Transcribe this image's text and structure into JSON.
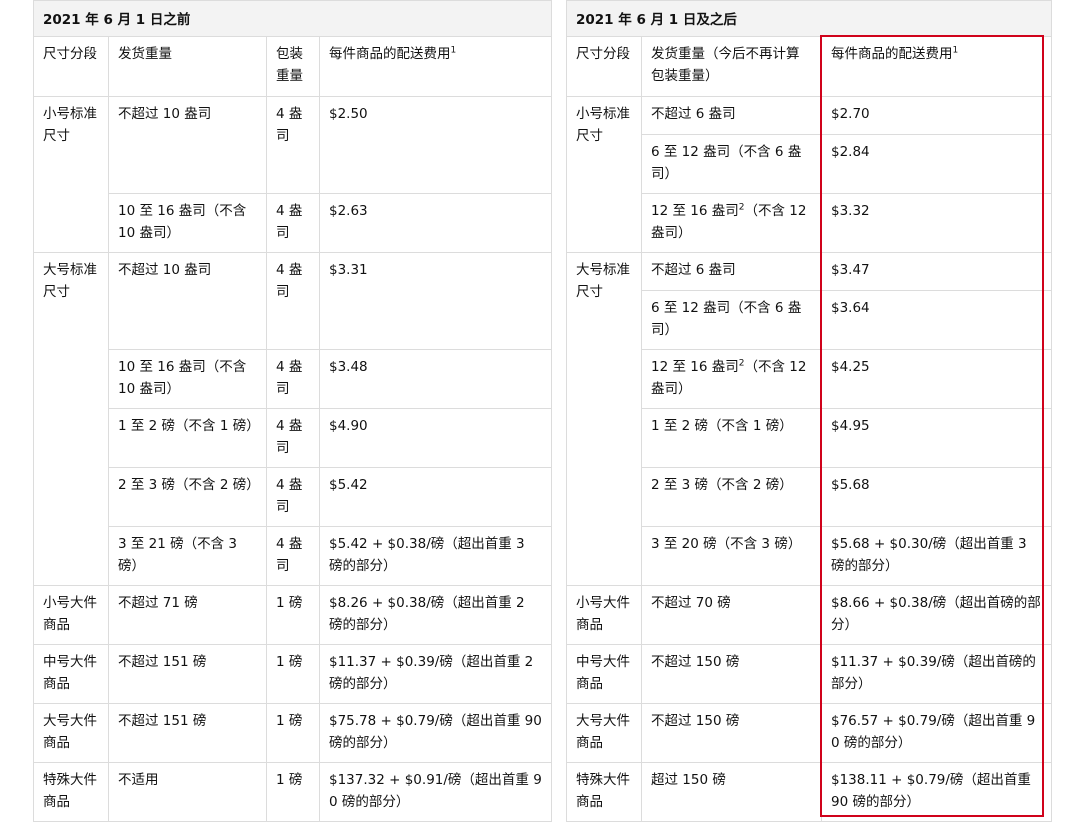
{
  "before": {
    "title": "2021 年 6 月 1 日之前",
    "headers": {
      "tier": "尺寸分段",
      "weight": "发货重量",
      "pack": "包装重量",
      "fee": "每件商品的配送费用",
      "fee_sup": "1"
    },
    "rows": [
      {
        "tier": "小号标准尺寸",
        "weight": "不超过 10 盎司",
        "pack": "4 盎司",
        "fee": "$2.50"
      },
      {
        "weight": "10 至 16 盎司（不含 10 盎司）",
        "pack": "4 盎司",
        "fee": "$2.63"
      },
      {
        "tier": "大号标准尺寸",
        "weight": "不超过 10 盎司",
        "pack": "4 盎司",
        "fee": "$3.31"
      },
      {
        "weight": "10 至 16 盎司（不含 10 盎司）",
        "pack": "4 盎司",
        "fee": "$3.48"
      },
      {
        "weight": "1 至 2 磅（不含 1 磅）",
        "pack": "4 盎司",
        "fee": "$4.90"
      },
      {
        "weight": "2 至 3 磅（不含 2 磅）",
        "pack": "4 盎司",
        "fee": "$5.42"
      },
      {
        "weight": "3 至 21 磅（不含 3 磅）",
        "pack": "4 盎司",
        "fee": "$5.42 + $0.38/磅（超出首重 3 磅的部分）"
      },
      {
        "tier": "小号大件商品",
        "weight": "不超过 71 磅",
        "pack": "1 磅",
        "fee": "$8.26 + $0.38/磅（超出首重 2 磅的部分）"
      },
      {
        "tier": "中号大件商品",
        "weight": "不超过 151 磅",
        "pack": "1 磅",
        "fee": "$11.37 + $0.39/磅（超出首重 2 磅的部分）"
      },
      {
        "tier": "大号大件商品",
        "weight": "不超过 151 磅",
        "pack": "1 磅",
        "fee": "$75.78 + $0.79/磅（超出首重 90 磅的部分）"
      },
      {
        "tier": "特殊大件商品",
        "weight": "不适用",
        "pack": "1 磅",
        "fee": "$137.32 + $0.91/磅（超出首重 90 磅的部分）"
      }
    ]
  },
  "after": {
    "title": "2021 年 6 月 1 日及之后",
    "headers": {
      "tier": "尺寸分段",
      "weight": "发货重量（今后不再计算包装重量）",
      "fee": "每件商品的配送费用",
      "fee_sup": "1"
    },
    "rows": [
      {
        "tier": "小号标准尺寸",
        "weight": "不超过 6 盎司",
        "fee": "$2.70"
      },
      {
        "weight": "6 至 12 盎司（不含 6 盎司）",
        "fee": "$2.84"
      },
      {
        "weight_a": "12 至 16 盎司",
        "weight_sup": "2",
        "weight_b": "（不含 12 盎司）",
        "fee": "$3.32"
      },
      {
        "tier": "大号标准尺寸",
        "weight": "不超过 6 盎司",
        "fee": "$3.47"
      },
      {
        "weight": "6 至 12 盎司（不含 6 盎司）",
        "fee": "$3.64"
      },
      {
        "weight_a": "12 至 16 盎司",
        "weight_sup": "2",
        "weight_b": "（不含 12 盎司）",
        "fee": "$4.25"
      },
      {
        "weight": "1 至 2 磅（不含 1 磅）",
        "fee": "$4.95"
      },
      {
        "weight": "2 至 3 磅（不含 2 磅）",
        "fee": "$5.68"
      },
      {
        "weight": "3 至 20 磅（不含 3 磅）",
        "fee": "$5.68 + $0.30/磅（超出首重 3 磅的部分）"
      },
      {
        "tier": "小号大件商品",
        "weight": "不超过 70 磅",
        "fee": "$8.66 + $0.38/磅（超出首磅的部分）"
      },
      {
        "tier": "中号大件商品",
        "weight": "不超过 150 磅",
        "fee": "$11.37 + $0.39/磅（超出首磅的部分）"
      },
      {
        "tier": "大号大件商品",
        "weight": "不超过 150 磅",
        "fee": "$76.57 + $0.79/磅（超出首重 90 磅的部分）"
      },
      {
        "tier": "特殊大件商品",
        "weight": "超过 150 磅",
        "fee": "$138.11 + $0.79/磅（超出首重 90 磅的部分）"
      }
    ]
  },
  "highlight_color": "#d0021b"
}
